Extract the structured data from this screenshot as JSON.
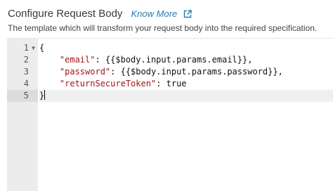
{
  "header": {
    "title": "Configure Request Body",
    "link_label": "Know More",
    "link_icon": "external-link-icon",
    "description": "The template which will transform your request body into the required specification."
  },
  "editor": {
    "active_line": 5,
    "lines": [
      {
        "number": "1",
        "foldable": true,
        "fold_icon": "fold-arrow-icon",
        "text_open": "{",
        "key": "",
        "rest": ""
      },
      {
        "number": "2",
        "foldable": false,
        "text_open": "    ",
        "key": "\"email\"",
        "rest": ": {{$body.input.params.email}},"
      },
      {
        "number": "3",
        "foldable": false,
        "text_open": "    ",
        "key": "\"password\"",
        "rest": ": {{$body.input.params.password}},"
      },
      {
        "number": "4",
        "foldable": false,
        "text_open": "    ",
        "key": "\"returnSecureToken\"",
        "rest": ": true"
      },
      {
        "number": "5",
        "foldable": false,
        "text_open": "}",
        "key": "",
        "rest": ""
      }
    ]
  }
}
